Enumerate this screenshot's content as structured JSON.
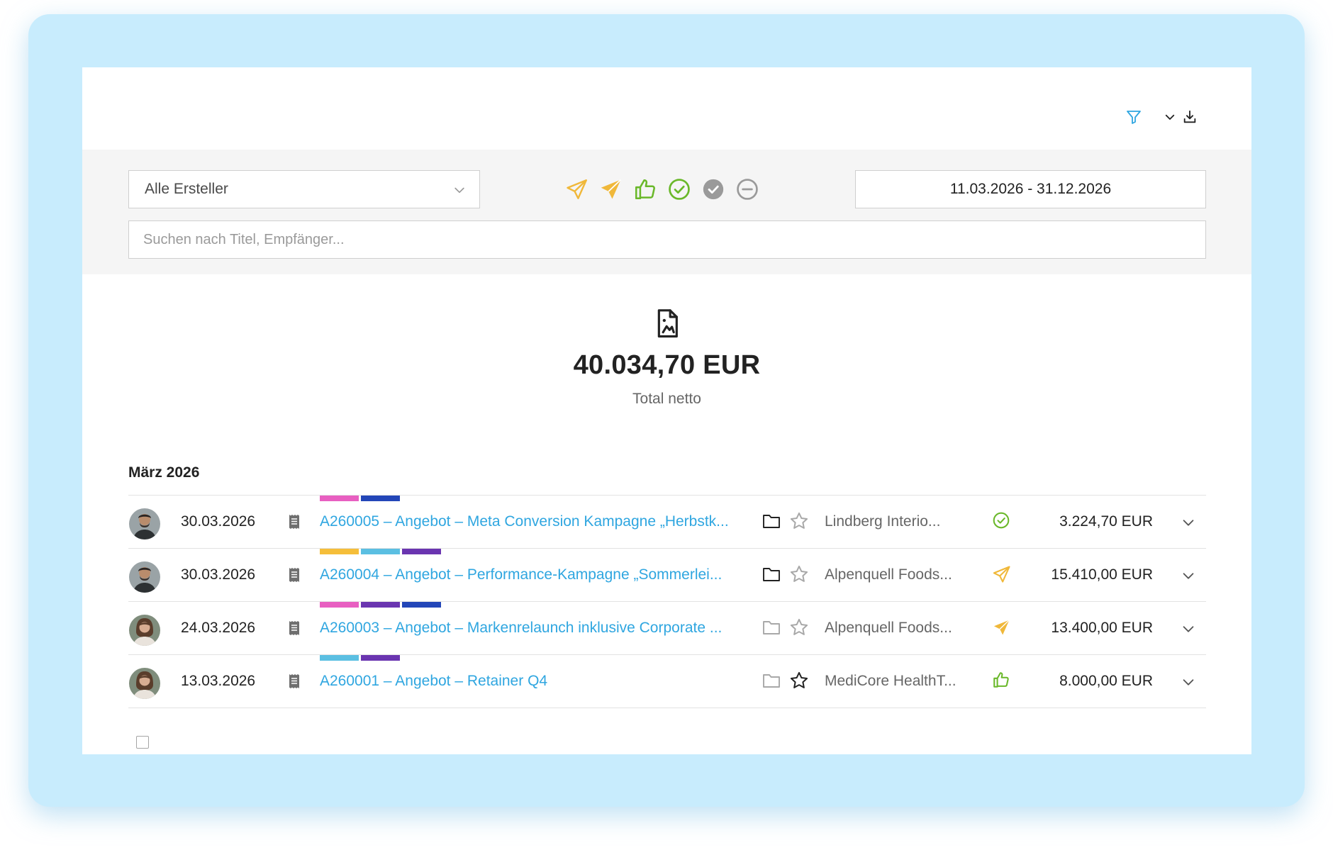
{
  "toolbar": {
    "filter_icon": "filter-icon",
    "export_icon": "download-icon"
  },
  "filters": {
    "creator_select": {
      "value": "Alle Ersteller"
    },
    "status_icons": [
      {
        "name": "sent-outline-icon",
        "color": "#f0b83a"
      },
      {
        "name": "sent-filled-icon",
        "color": "#f0b83a"
      },
      {
        "name": "thumbs-up-icon",
        "color": "#6ab82a"
      },
      {
        "name": "check-circle-icon",
        "color": "#6ab82a"
      },
      {
        "name": "check-filled-gray-icon",
        "color": "#9a9a9a"
      },
      {
        "name": "minus-circle-icon",
        "color": "#9a9a9a"
      }
    ],
    "date_range": "11.03.2026 - 31.12.2026",
    "search_placeholder": "Suchen nach Titel, Empfänger..."
  },
  "summary": {
    "total": "40.034,70 EUR",
    "label": "Total netto"
  },
  "month": "März 2026",
  "rows": [
    {
      "date": "30.03.2026",
      "title": "A260005 – Angebot – Meta Conversion Kampagne „Herbstk...",
      "client": "Lindberg Interio...",
      "amount": "3.224,70 EUR",
      "status": "check-circle-icon",
      "tags": [
        "#e85fc1",
        "#2346b8"
      ],
      "folder_active": true,
      "starred": false,
      "avatar": "man"
    },
    {
      "date": "30.03.2026",
      "title": "A260004 – Angebot – Performance-Kampagne „Sommerlei...",
      "client": "Alpenquell Foods...",
      "amount": "15.410,00 EUR",
      "status": "sent-outline-icon",
      "tags": [
        "#f5be3a",
        "#5bbfe2",
        "#6a35b0"
      ],
      "folder_active": true,
      "starred": false,
      "avatar": "man"
    },
    {
      "date": "24.03.2026",
      "title": "A260003 – Angebot – Markenrelaunch inklusive Corporate ...",
      "client": "Alpenquell Foods...",
      "amount": "13.400,00 EUR",
      "status": "sent-filled-icon",
      "tags": [
        "#e85fc1",
        "#6a35b0",
        "#2346b8"
      ],
      "folder_active": false,
      "starred": false,
      "avatar": "woman"
    },
    {
      "date": "13.03.2026",
      "title": "A260001 – Angebot – Retainer Q4",
      "client": "MediCore HealthT...",
      "amount": "8.000,00 EUR",
      "status": "thumbs-up-icon",
      "tags": [
        "#5bbfe2",
        "#6a35b0"
      ],
      "folder_active": false,
      "starred": true,
      "avatar": "woman"
    }
  ]
}
